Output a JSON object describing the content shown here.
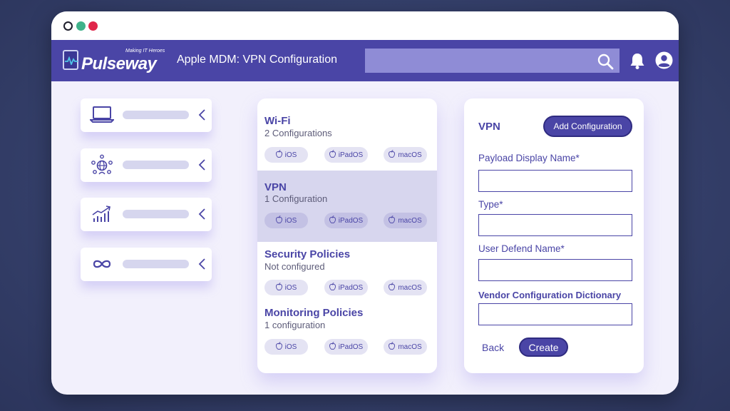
{
  "window": {
    "controls": [
      "close",
      "minimize",
      "maximize"
    ]
  },
  "header": {
    "brand": "Pulseway",
    "tagline": "Making IT Heroes",
    "title": "Apple MDM: VPN Configuration",
    "search": {
      "value": "",
      "placeholder": ""
    },
    "icons": [
      "search-icon",
      "bell-icon",
      "user-icon"
    ]
  },
  "sidebar": {
    "items": [
      {
        "icon": "laptop-icon"
      },
      {
        "icon": "network-users-icon"
      },
      {
        "icon": "growth-chart-icon"
      },
      {
        "icon": "infinity-icon"
      }
    ]
  },
  "configurations": [
    {
      "title": "Wi-Fi",
      "subtitle": "2 Configurations",
      "selected": false,
      "platforms": [
        "iOS",
        "iPadOS",
        "macOS"
      ]
    },
    {
      "title": "VPN",
      "subtitle": "1 Configuration",
      "selected": true,
      "platforms": [
        "iOS",
        "iPadOS",
        "macOS"
      ]
    },
    {
      "title": "Security Policies",
      "subtitle": "Not configured",
      "selected": false,
      "platforms": [
        "iOS",
        "iPadOS",
        "macOS"
      ]
    },
    {
      "title": "Monitoring Policies",
      "subtitle": "1 configuration",
      "selected": false,
      "platforms": [
        "iOS",
        "iPadOS",
        "macOS"
      ]
    }
  ],
  "form": {
    "title": "VPN",
    "add_button": "Add Configuration",
    "fields": [
      {
        "label": "Payload Display Name*",
        "value": ""
      },
      {
        "label": "Type*",
        "value": ""
      },
      {
        "label": "User Defend Name*",
        "value": ""
      },
      {
        "label": "Vendor Configuration Dictionary",
        "value": ""
      }
    ],
    "back_label": "Back",
    "create_label": "Create"
  },
  "colors": {
    "accent": "#4a45a6",
    "background": "#2c355c",
    "window": "#f2f0fc",
    "selected_row": "#d7d6ee",
    "search_bar": "#8f8cd6"
  }
}
